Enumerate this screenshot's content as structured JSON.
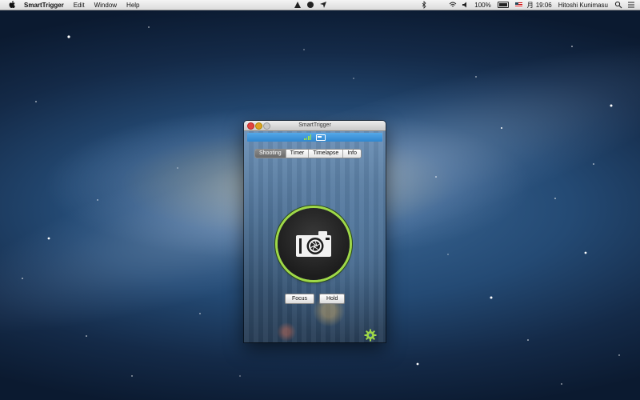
{
  "menubar": {
    "app_name": "SmartTrigger",
    "items": [
      "Edit",
      "Window",
      "Help"
    ],
    "battery_percent": "100%",
    "day": "月",
    "time": "19:06",
    "user": "Hitoshi Kunimasu"
  },
  "window": {
    "title": "SmartTrigger",
    "tabs": [
      {
        "label": "Shooting",
        "active": true
      },
      {
        "label": "Timer",
        "active": false
      },
      {
        "label": "Timelapse",
        "active": false
      },
      {
        "label": "Info",
        "active": false
      }
    ],
    "focus_label": "Focus",
    "hold_label": "Hold"
  },
  "icons": {
    "shutter": "camera-icon",
    "settings": "gear-icon",
    "signal": "signal-icon",
    "battery": "battery-icon"
  },
  "colors": {
    "accent_green": "#9fd848",
    "status_blue": "#2f86cf"
  }
}
